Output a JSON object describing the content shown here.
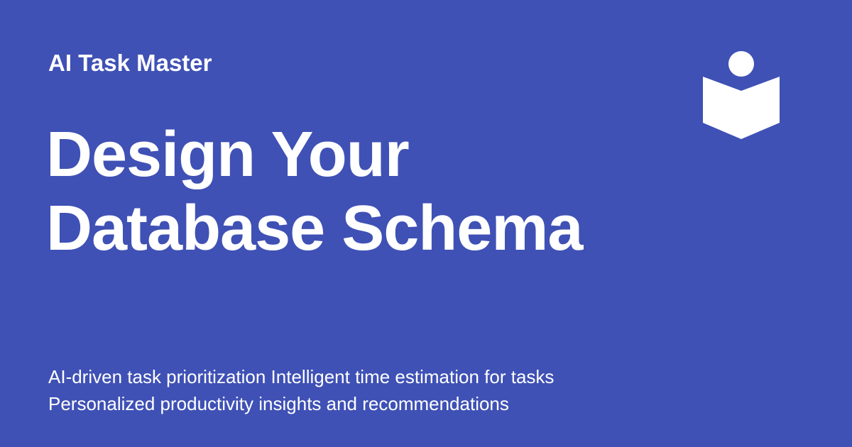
{
  "brand": {
    "name": "AI Task Master"
  },
  "headline": {
    "lines": [
      "Design Your",
      "Database Schema"
    ]
  },
  "tagline": {
    "lines": [
      "AI-driven task prioritization Intelligent time estimation for tasks",
      "Personalized productivity insights and recommendations"
    ]
  },
  "logo": {
    "icon": "reader-book-icon"
  },
  "colors": {
    "background": "#3f51b5",
    "foreground": "#ffffff"
  }
}
